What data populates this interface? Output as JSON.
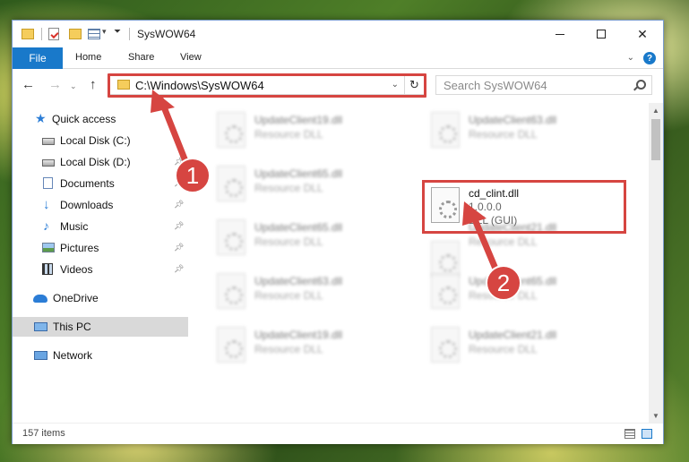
{
  "window": {
    "title": "SysWOW64",
    "minimize_glyph": "",
    "maximize_glyph": "",
    "close_glyph": "✕"
  },
  "ribbon": {
    "file": "File",
    "home": "Home",
    "share": "Share",
    "view": "View",
    "help": "?"
  },
  "navigation": {
    "address": "C:\\Windows\\SysWOW64",
    "search_placeholder": "Search SysWOW64"
  },
  "sidebar": {
    "items": [
      {
        "label": "Quick access",
        "icon": "star-icon",
        "pinned": false
      },
      {
        "label": "Local Disk (C:)",
        "icon": "drive-icon",
        "pinned": false
      },
      {
        "label": "Local Disk (D:)",
        "icon": "drive-icon",
        "pinned": true
      },
      {
        "label": "Documents",
        "icon": "documents-icon",
        "pinned": true
      },
      {
        "label": "Downloads",
        "icon": "downloads-icon",
        "pinned": true
      },
      {
        "label": "Music",
        "icon": "music-icon",
        "pinned": true
      },
      {
        "label": "Pictures",
        "icon": "pictures-icon",
        "pinned": true
      },
      {
        "label": "Videos",
        "icon": "videos-icon",
        "pinned": true
      },
      {
        "label": "OneDrive",
        "icon": "onedrive-icon",
        "pinned": false
      },
      {
        "label": "This PC",
        "icon": "this-pc-icon",
        "pinned": false,
        "selected": true
      },
      {
        "label": "Network",
        "icon": "network-icon",
        "pinned": false
      }
    ]
  },
  "files": {
    "left": [
      {
        "name": "UpdateClient19.dll",
        "type": "Resource DLL"
      },
      {
        "name": "UpdateClient65.dll",
        "type": "Resource DLL"
      },
      {
        "name": "UpdateClient65.dll",
        "type": "Resource DLL"
      },
      {
        "name": "UpdateClient63.dll",
        "type": "Resource DLL"
      },
      {
        "name": "UpdateClient19.dll",
        "type": "Resource DLL"
      }
    ],
    "right": [
      {
        "name": "UpdateClient63.dll",
        "type": "Resource DLL"
      },
      {
        "name": "UpdateClient21.dll",
        "type": "Resource DLL"
      },
      {
        "name": "UpdateClient65.dll",
        "type": "Resource DLL"
      },
      {
        "name": "UpdateClient21.dll",
        "type": "Resource DLL"
      }
    ],
    "highlighted": {
      "name": "cd_clint.dll",
      "version": "1.0.0.0",
      "type": "DLL (GUI)"
    }
  },
  "status": {
    "count": "157 items"
  },
  "annotations": {
    "step1": "1",
    "step2": "2",
    "color": "#d64541"
  }
}
